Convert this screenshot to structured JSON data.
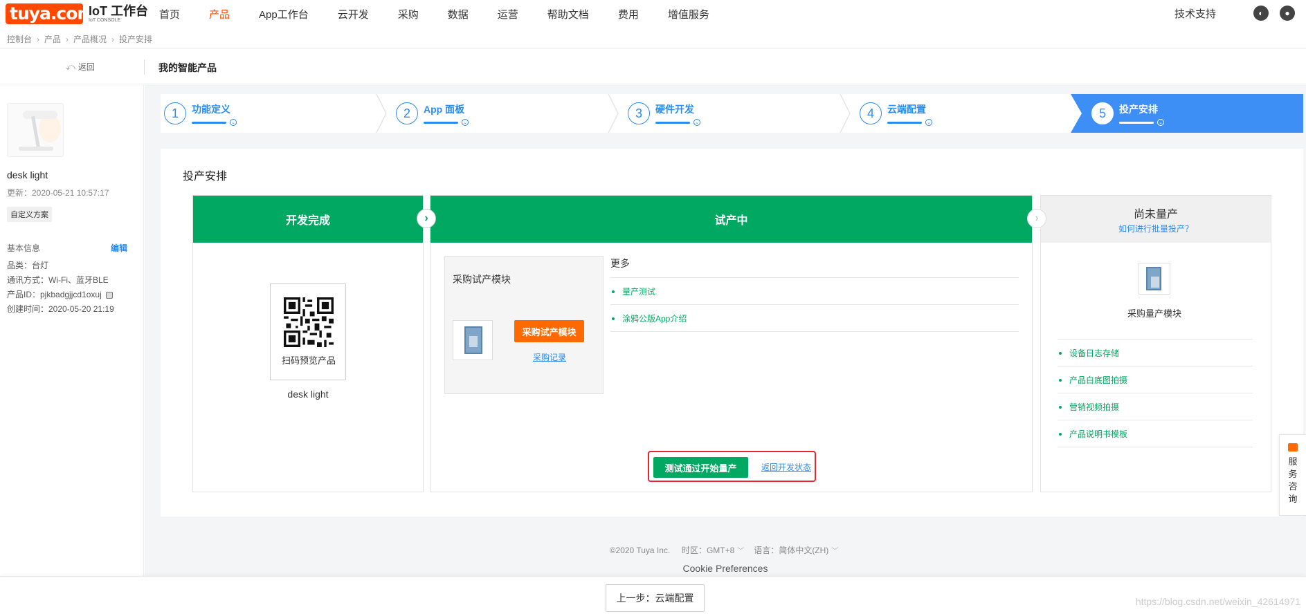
{
  "nav": {
    "logo_text": "tuya.com",
    "logo_title": "IoT 工作台",
    "logo_sub": "IoT CONSOLE",
    "items": [
      "首页",
      "产品",
      "App工作台",
      "云开发",
      "采购",
      "数据",
      "运营",
      "帮助文档",
      "费用",
      "增值服务"
    ],
    "active_index": 1,
    "support": "技术支持"
  },
  "breadcrumb": [
    "控制台",
    "产品",
    "产品概况",
    "投产安排"
  ],
  "subheader": {
    "back": "返回",
    "title": "我的智能产品"
  },
  "sidebar": {
    "product_name": "desk light",
    "updated": "更新：2020-05-21 10:57:17",
    "scheme_tag": "自定义方案",
    "basic_info": "基本信息",
    "edit": "编辑",
    "category": "品类：台灯",
    "protocol": "通讯方式：Wi-Fi、蓝牙BLE",
    "product_id": "产品ID：pjkbadgjjcd1oxuj",
    "created": "创建时间：2020-05-20 21:19"
  },
  "steps": [
    {
      "num": "1",
      "label": "功能定义"
    },
    {
      "num": "2",
      "label": "App 面板"
    },
    {
      "num": "3",
      "label": "硬件开发"
    },
    {
      "num": "4",
      "label": "云端配置"
    },
    {
      "num": "5",
      "label": "投产安排"
    }
  ],
  "card": {
    "title": "投产安排",
    "col1": {
      "head": "开发完成",
      "qr_label": "扫码预览产品",
      "name": "desk light"
    },
    "col2": {
      "head": "试产中",
      "trial_title": "采购试产模块",
      "buy_button": "采购试产模块",
      "record_link": "采购记录",
      "more_title": "更多",
      "more_items": [
        "量产测试",
        "涂鸦公版App介绍"
      ],
      "start_button": "测试通过开始量产",
      "back_dev": "返回开发状态"
    },
    "col3": {
      "head": "尚未量产",
      "sublink": "如何进行批量投产？",
      "module_label": "采购量产模块",
      "items": [
        "设备日志存储",
        "产品白底图拍摄",
        "营销视频拍摄",
        "产品说明书模板"
      ]
    }
  },
  "footer": {
    "copyright": "©2020 Tuya Inc.",
    "tz_label": "时区：",
    "tz_value": "GMT+8",
    "lang_label": "语言：",
    "lang_value": "简体中文(ZH)",
    "cookie": "Cookie Preferences"
  },
  "bottom": {
    "prev_button": "上一步：云端配置",
    "watermark": "https://blog.csdn.net/weixin_42614971"
  },
  "side_consult": [
    "服",
    "务",
    "咨",
    "询"
  ],
  "colors": {
    "brand": "#ff4800",
    "green": "#00a862",
    "blue": "#2a8cf0",
    "step_active": "#3d8ff5",
    "orange_btn": "#ff6a00",
    "highlight": "#e8242e"
  }
}
